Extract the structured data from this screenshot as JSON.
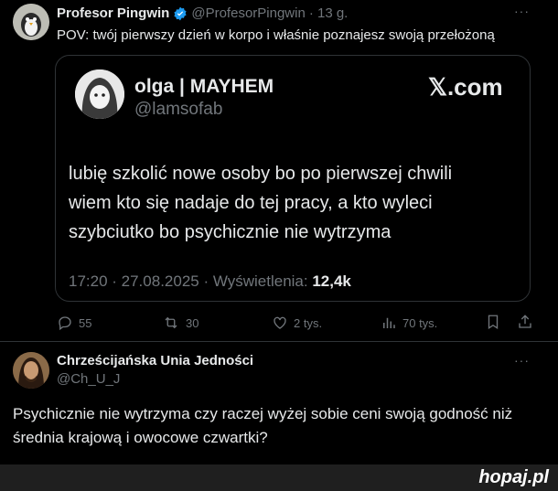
{
  "tweet": {
    "author_name": "Profesor Pingwin",
    "author_handle": "@ProfesorPingwin",
    "time": "· 13 g.",
    "more": "···",
    "text": "POV: twój pierwszy dzień w korpo i właśnie poznajesz swoją przełożoną",
    "actions": {
      "replies": "55",
      "retweets": "30",
      "likes": "2 tys.",
      "views": "70 tys."
    }
  },
  "quoted": {
    "author_name": "olga | MAYHEM",
    "author_handle": "@lamsofab",
    "brand": "𝕏.com",
    "text_lines": [
      "lubię szkolić nowe osoby bo po pierwszej chwili",
      "wiem kto się nadaje do tej pracy, a kto wyleci",
      "szybciutko bo psychicznie nie wytrzyma"
    ],
    "meta": "17:20 · 27.08.2025 · Wyświetlenia:",
    "views": "12,4k"
  },
  "reply": {
    "author_name": "Chrześcijańska Unia Jedności",
    "author_handle": "@Ch_U_J",
    "more": "···",
    "text_lines": [
      "Psychicznie nie wytrzyma czy raczej wyżej sobie ceni swoją godność niż",
      "średnia krajową i owocowe czwartki?"
    ]
  },
  "watermark": "hopaj.pl",
  "colors": {
    "background": "#000000",
    "text": "#e7e9ea",
    "muted": "#71767b",
    "verified": "#1d9bf0",
    "border": "#2f3336"
  }
}
